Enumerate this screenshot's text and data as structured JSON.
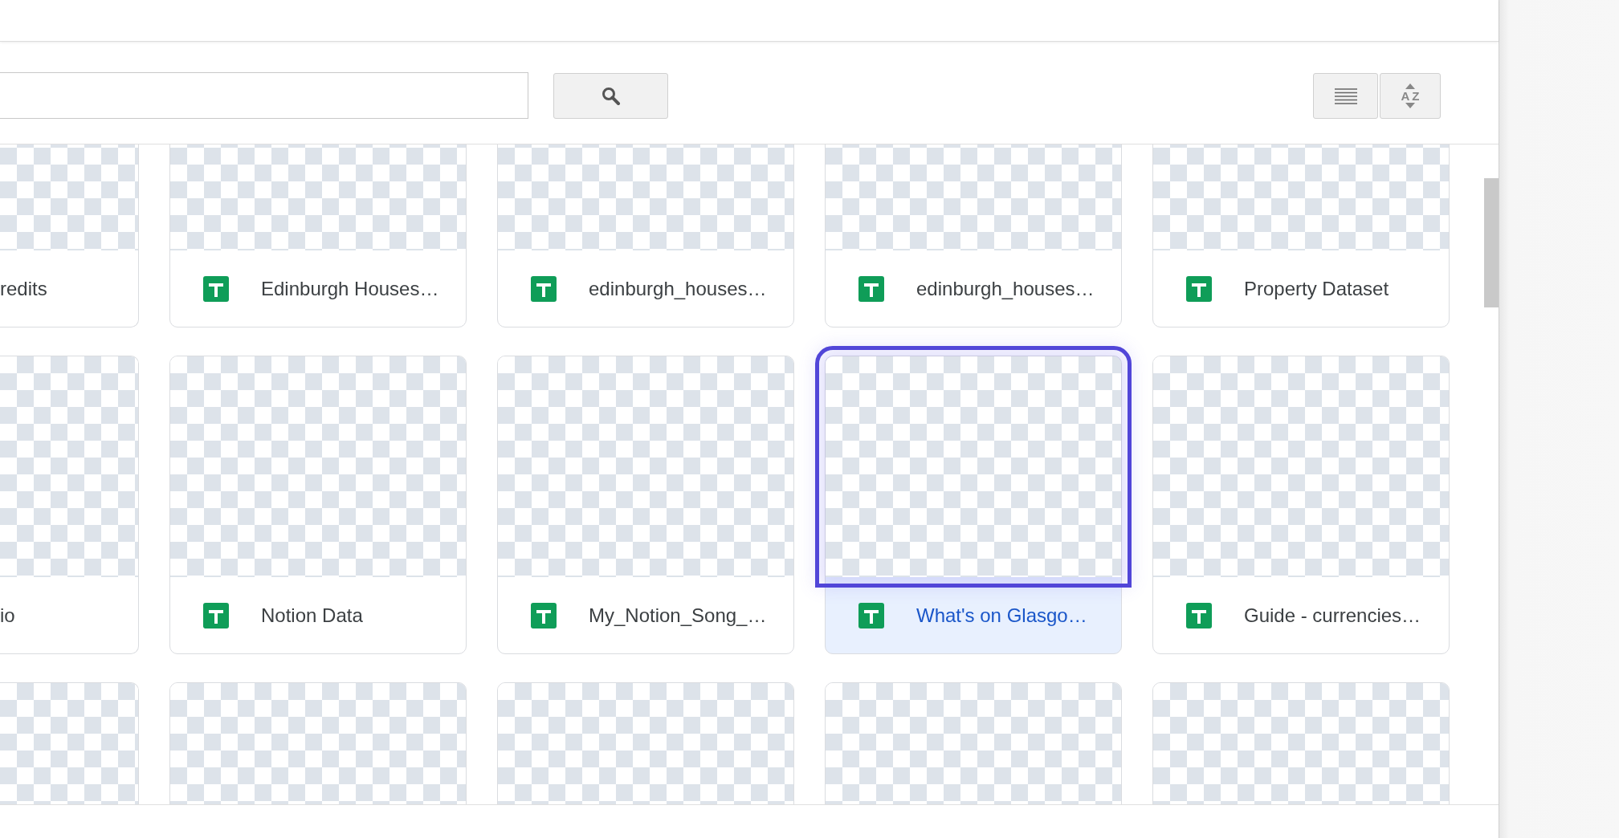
{
  "toolbar": {
    "sort_button": {
      "label": "AZ"
    }
  },
  "rows": [
    {
      "cards": [
        {
          "kind": "cut",
          "name": "redits",
          "selected": false
        },
        {
          "kind": "sheet",
          "name": "Edinburgh Houses…",
          "selected": false
        },
        {
          "kind": "sheet",
          "name": "edinburgh_houses…",
          "selected": false
        },
        {
          "kind": "sheet",
          "name": "edinburgh_houses…",
          "selected": false
        },
        {
          "kind": "sheet",
          "name": "Property Dataset",
          "selected": false
        }
      ]
    },
    {
      "cards": [
        {
          "kind": "cut",
          "name": "io",
          "selected": false
        },
        {
          "kind": "sheet",
          "name": "Notion Data",
          "selected": false
        },
        {
          "kind": "sheet",
          "name": "My_Notion_Song_…",
          "selected": false
        },
        {
          "kind": "sheet",
          "name": "What's on Glasgo…",
          "selected": true
        },
        {
          "kind": "sheet",
          "name": "Guide - currencies…",
          "selected": false
        }
      ]
    },
    {
      "cards": [
        {
          "kind": "cut",
          "selected": false
        },
        {
          "kind": "sheet",
          "selected": false
        },
        {
          "kind": "sheet",
          "selected": false
        },
        {
          "kind": "sheet",
          "selected": false
        },
        {
          "kind": "sheet",
          "selected": false
        }
      ]
    }
  ]
}
